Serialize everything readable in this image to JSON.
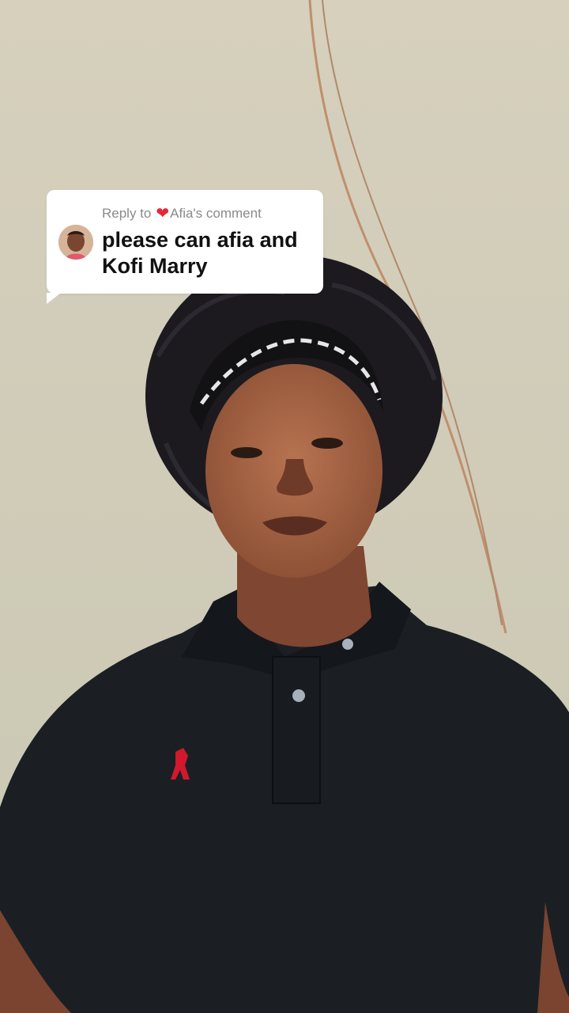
{
  "video": {
    "description": "Selfie video frame"
  },
  "reply_card": {
    "prefix": "Reply to",
    "heart_icon": "red-heart",
    "commenter": "Afia's comment",
    "comment": "please can afia and Kofi Marry"
  },
  "colors": {
    "bubble_bg": "#ffffff",
    "heart": "#e3283a",
    "header_text": "#8a8a8a",
    "comment_text": "#111111"
  }
}
